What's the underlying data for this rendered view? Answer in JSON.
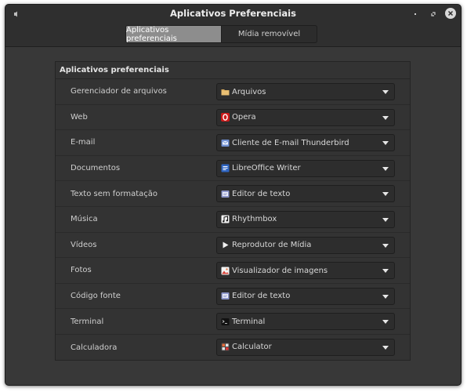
{
  "window": {
    "title": "Aplicativos Preferenciais"
  },
  "tabs": [
    {
      "label": "Aplicativos preferenciais",
      "active": true
    },
    {
      "label": "Mídia removível",
      "active": false
    }
  ],
  "panel": {
    "header": "Aplicativos preferenciais",
    "rows": [
      {
        "label": "Gerenciador de arquivos",
        "value": "Arquivos",
        "icon": "folder-icon"
      },
      {
        "label": "Web",
        "value": "Opera",
        "icon": "opera-icon"
      },
      {
        "label": "E-mail",
        "value": "Cliente de E-mail Thunderbird",
        "icon": "thunderbird-icon"
      },
      {
        "label": "Documentos",
        "value": "LibreOffice Writer",
        "icon": "libreoffice-writer-icon"
      },
      {
        "label": "Texto sem formatação",
        "value": "Editor de texto",
        "icon": "text-editor-icon"
      },
      {
        "label": "Música",
        "value": "Rhythmbox",
        "icon": "rhythmbox-icon"
      },
      {
        "label": "Vídeos",
        "value": "Reprodutor de Mídia",
        "icon": "media-player-icon"
      },
      {
        "label": "Fotos",
        "value": "Visualizador de imagens",
        "icon": "image-viewer-icon"
      },
      {
        "label": "Código fonte",
        "value": "Editor de texto",
        "icon": "text-editor-icon"
      },
      {
        "label": "Terminal",
        "value": "Terminal",
        "icon": "terminal-icon"
      },
      {
        "label": "Calculadora",
        "value": "Calculator",
        "icon": "calculator-icon"
      }
    ]
  }
}
